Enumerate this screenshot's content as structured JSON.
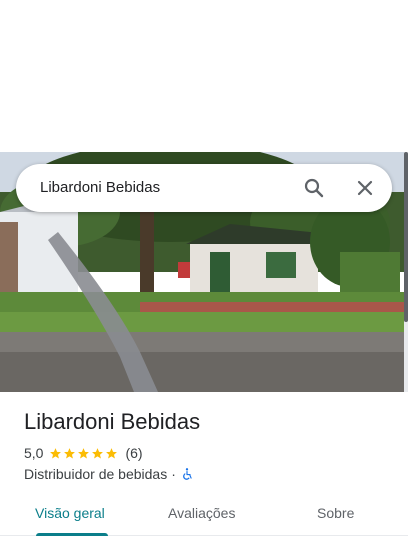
{
  "search": {
    "query": "Libardoni Bebidas"
  },
  "place": {
    "name": "Libardoni Bebidas",
    "rating": "5,0",
    "stars": 5,
    "review_count": "(6)",
    "category": "Distribuidor de bebidas",
    "separator": "·"
  },
  "tabs": [
    {
      "label": "Visão geral",
      "selected": true
    },
    {
      "label": "Avaliações",
      "selected": false
    },
    {
      "label": "Sobre",
      "selected": false
    }
  ],
  "colors": {
    "accent": "#0b7e8a",
    "star": "#fbbc04",
    "accessibility": "#1a73e8"
  },
  "icons": {
    "search": "search-icon",
    "close": "close-icon",
    "star": "star-icon",
    "accessibility": "wheelchair-icon"
  }
}
